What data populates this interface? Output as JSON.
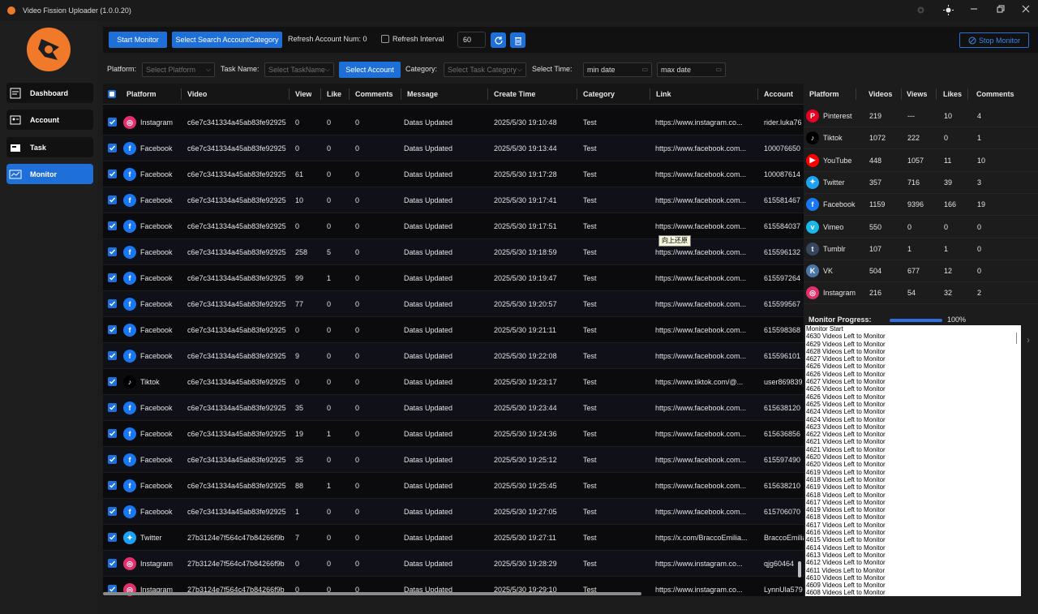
{
  "window": {
    "title": "Video Fission Uploader (1.0.0.20)"
  },
  "sidebar": {
    "items": [
      {
        "label": "Dashboard",
        "icon": "dashboard-icon"
      },
      {
        "label": "Account",
        "icon": "account-card-icon"
      },
      {
        "label": "Task",
        "icon": "task-icon"
      },
      {
        "label": "Monitor",
        "icon": "monitor-chart-icon"
      }
    ]
  },
  "toolbar": {
    "start_monitor": "Start Monitor",
    "select_search": "Select Search AccountCategory",
    "refresh_account_num": "Refresh Account Num: 0",
    "refresh_interval_label": "Refresh Interval",
    "refresh_interval_value": "60",
    "stop_monitor": "Stop Monitor"
  },
  "filters": {
    "platform_label": "Platform:",
    "platform_placeholder": "Select Platform",
    "task_label": "Task Name:",
    "task_placeholder": "Select TaskName",
    "select_account": "Select Account",
    "category_label": "Category:",
    "category_placeholder": "Select Task Category",
    "time_label": "Select Time:",
    "min_date": "min date",
    "max_date": "max date"
  },
  "table": {
    "columns": [
      "Platform",
      "Video",
      "View",
      "Like",
      "Comments",
      "Message",
      "Create Time",
      "Category",
      "Link",
      "Account"
    ],
    "rows": [
      {
        "platform": "Instagram",
        "video": "c6e7c341334a45ab83fe92925",
        "view": "0",
        "like": "0",
        "comments": "0",
        "message": "Datas Updated",
        "time": "2025/5/30 19:10:48",
        "category": "Test",
        "link": "https://www.instagram.co...",
        "account": "rider.luka76"
      },
      {
        "platform": "Facebook",
        "video": "c6e7c341334a45ab83fe92925",
        "view": "0",
        "like": "0",
        "comments": "0",
        "message": "Datas Updated",
        "time": "2025/5/30 19:13:44",
        "category": "Test",
        "link": "https://www.facebook.com...",
        "account": "100076650"
      },
      {
        "platform": "Facebook",
        "video": "c6e7c341334a45ab83fe92925",
        "view": "61",
        "like": "0",
        "comments": "0",
        "message": "Datas Updated",
        "time": "2025/5/30 19:17:28",
        "category": "Test",
        "link": "https://www.facebook.com...",
        "account": "100087614"
      },
      {
        "platform": "Facebook",
        "video": "c6e7c341334a45ab83fe92925",
        "view": "10",
        "like": "0",
        "comments": "0",
        "message": "Datas Updated",
        "time": "2025/5/30 19:17:41",
        "category": "Test",
        "link": "https://www.facebook.com...",
        "account": "615581467"
      },
      {
        "platform": "Facebook",
        "video": "c6e7c341334a45ab83fe92925",
        "view": "0",
        "like": "0",
        "comments": "0",
        "message": "Datas Updated",
        "time": "2025/5/30 19:17:51",
        "category": "Test",
        "link": "https://www.facebook.com...",
        "account": "615584037"
      },
      {
        "platform": "Facebook",
        "video": "c6e7c341334a45ab83fe92925",
        "view": "258",
        "like": "5",
        "comments": "0",
        "message": "Datas Updated",
        "time": "2025/5/30 19:18:59",
        "category": "Test",
        "link": "https://www.facebook.com...",
        "account": "615596132"
      },
      {
        "platform": "Facebook",
        "video": "c6e7c341334a45ab83fe92925",
        "view": "99",
        "like": "1",
        "comments": "0",
        "message": "Datas Updated",
        "time": "2025/5/30 19:19:47",
        "category": "Test",
        "link": "https://www.facebook.com...",
        "account": "615597264"
      },
      {
        "platform": "Facebook",
        "video": "c6e7c341334a45ab83fe92925",
        "view": "77",
        "like": "0",
        "comments": "0",
        "message": "Datas Updated",
        "time": "2025/5/30 19:20:57",
        "category": "Test",
        "link": "https://www.facebook.com...",
        "account": "615599567"
      },
      {
        "platform": "Facebook",
        "video": "c6e7c341334a45ab83fe92925",
        "view": "0",
        "like": "0",
        "comments": "0",
        "message": "Datas Updated",
        "time": "2025/5/30 19:21:11",
        "category": "Test",
        "link": "https://www.facebook.com...",
        "account": "615598368"
      },
      {
        "platform": "Facebook",
        "video": "c6e7c341334a45ab83fe92925",
        "view": "9",
        "like": "0",
        "comments": "0",
        "message": "Datas Updated",
        "time": "2025/5/30 19:22:08",
        "category": "Test",
        "link": "https://www.facebook.com...",
        "account": "615596101"
      },
      {
        "platform": "Tiktok",
        "video": "c6e7c341334a45ab83fe92925",
        "view": "0",
        "like": "0",
        "comments": "0",
        "message": "Datas Updated",
        "time": "2025/5/30 19:23:17",
        "category": "Test",
        "link": "https://www.tiktok.com/@...",
        "account": "user869839"
      },
      {
        "platform": "Facebook",
        "video": "c6e7c341334a45ab83fe92925",
        "view": "35",
        "like": "0",
        "comments": "0",
        "message": "Datas Updated",
        "time": "2025/5/30 19:23:44",
        "category": "Test",
        "link": "https://www.facebook.com...",
        "account": "615638120"
      },
      {
        "platform": "Facebook",
        "video": "c6e7c341334a45ab83fe92925",
        "view": "19",
        "like": "1",
        "comments": "0",
        "message": "Datas Updated",
        "time": "2025/5/30 19:24:36",
        "category": "Test",
        "link": "https://www.facebook.com...",
        "account": "615636856"
      },
      {
        "platform": "Facebook",
        "video": "c6e7c341334a45ab83fe92925",
        "view": "35",
        "like": "0",
        "comments": "0",
        "message": "Datas Updated",
        "time": "2025/5/30 19:25:12",
        "category": "Test",
        "link": "https://www.facebook.com...",
        "account": "615597490"
      },
      {
        "platform": "Facebook",
        "video": "c6e7c341334a45ab83fe92925",
        "view": "88",
        "like": "1",
        "comments": "0",
        "message": "Datas Updated",
        "time": "2025/5/30 19:25:45",
        "category": "Test",
        "link": "https://www.facebook.com...",
        "account": "615638210"
      },
      {
        "platform": "Facebook",
        "video": "c6e7c341334a45ab83fe92925",
        "view": "1",
        "like": "0",
        "comments": "0",
        "message": "Datas Updated",
        "time": "2025/5/30 19:27:05",
        "category": "Test",
        "link": "https://www.facebook.com...",
        "account": "615706070"
      },
      {
        "platform": "Twitter",
        "video": "27b3124e7f564c47b84266f9b",
        "view": "7",
        "like": "0",
        "comments": "0",
        "message": "Datas Updated",
        "time": "2025/5/30 19:27:11",
        "category": "Test",
        "link": "https://x.com/BraccoEmilia...",
        "account": "BraccoEmilia"
      },
      {
        "platform": "Instagram",
        "video": "27b3124e7f564c47b84266f9b",
        "view": "0",
        "like": "0",
        "comments": "0",
        "message": "Datas Updated",
        "time": "2025/5/30 19:28:29",
        "category": "Test",
        "link": "https://www.instagram.co...",
        "account": "qjg60464"
      },
      {
        "platform": "Instagram",
        "video": "27b3124e7f564c47b84266f9b",
        "view": "0",
        "like": "0",
        "comments": "0",
        "message": "Datas Updated",
        "time": "2025/5/30 19:29:10",
        "category": "Test",
        "link": "https://www.instagram.co...",
        "account": "LynnUla579"
      }
    ]
  },
  "tooltip": "向上还原",
  "stats": {
    "columns": [
      "Platform",
      "Videos",
      "Views",
      "Likes",
      "Comments"
    ],
    "rows": [
      {
        "platform": "Pinterest",
        "videos": "219",
        "views": "---",
        "likes": "10",
        "comments": "4"
      },
      {
        "platform": "Tiktok",
        "videos": "1072",
        "views": "222",
        "likes": "0",
        "comments": "1"
      },
      {
        "platform": "YouTube",
        "videos": "448",
        "views": "1057",
        "likes": "11",
        "comments": "10"
      },
      {
        "platform": "Twitter",
        "videos": "357",
        "views": "716",
        "likes": "39",
        "comments": "3"
      },
      {
        "platform": "Facebook",
        "videos": "1159",
        "views": "9396",
        "likes": "166",
        "comments": "19"
      },
      {
        "platform": "Vimeo",
        "videos": "550",
        "views": "0",
        "likes": "0",
        "comments": "0"
      },
      {
        "platform": "Tumblr",
        "videos": "107",
        "views": "1",
        "likes": "1",
        "comments": "0"
      },
      {
        "platform": "VK",
        "videos": "504",
        "views": "677",
        "likes": "12",
        "comments": "0"
      },
      {
        "platform": "Instagram",
        "videos": "216",
        "views": "54",
        "likes": "32",
        "comments": "2"
      }
    ]
  },
  "progress": {
    "label": "Monitor Progress:",
    "value": 100,
    "text": "100%"
  },
  "log": [
    "Monitor Start",
    "4630 Videos Left to Monitor",
    "4629 Videos Left to Monitor",
    "4628 Videos Left to Monitor",
    "4627 Videos Left to Monitor",
    "4626 Videos Left to Monitor",
    "4626 Videos Left to Monitor",
    "4627 Videos Left to Monitor",
    "4626 Videos Left to Monitor",
    "4626 Videos Left to Monitor",
    "4625 Videos Left to Monitor",
    "4624 Videos Left to Monitor",
    "4624 Videos Left to Monitor",
    "4623 Videos Left to Monitor",
    "4622 Videos Left to Monitor",
    "4621 Videos Left to Monitor",
    "4621 Videos Left to Monitor",
    "4620 Videos Left to Monitor",
    "4620 Videos Left to Monitor",
    "4619 Videos Left to Monitor",
    "4618 Videos Left to Monitor",
    "4619 Videos Left to Monitor",
    "4618 Videos Left to Monitor",
    "4617 Videos Left to Monitor",
    "4619 Videos Left to Monitor",
    "4618 Videos Left to Monitor",
    "4617 Videos Left to Monitor",
    "4616 Videos Left to Monitor",
    "4615 Videos Left to Monitor",
    "4614 Videos Left to Monitor",
    "4613 Videos Left to Monitor",
    "4612 Videos Left to Monitor",
    "4611 Videos Left to Monitor",
    "4610 Videos Left to Monitor",
    "4609 Videos Left to Monitor",
    "4608 Videos Left to Monitor"
  ],
  "colors": {
    "accent": "#1f6fd9",
    "brand": "#f07a2a",
    "instagram": "#e1306c",
    "facebook": "#1877f2",
    "tiktok": "#000000",
    "twitter": "#1da1f2",
    "pinterest": "#e60023",
    "youtube": "#ff0000",
    "vimeo": "#1ab7ea",
    "tumblr": "#36465d",
    "vk": "#4a76a8"
  }
}
